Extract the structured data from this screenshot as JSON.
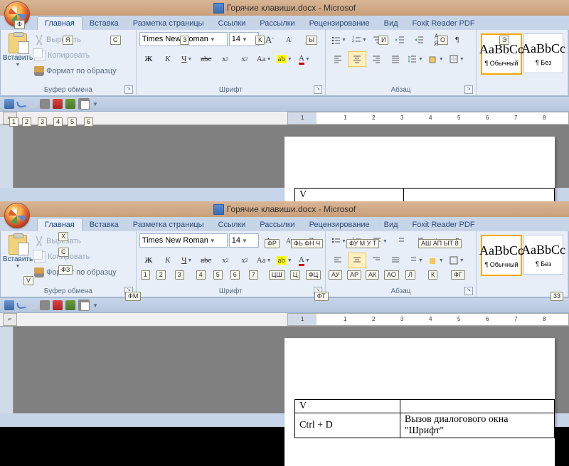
{
  "title": "Горячие клавиши.docx - Microsof",
  "office_keytip": "Ф",
  "tabs": [
    {
      "label": "Главная",
      "kt": "Я"
    },
    {
      "label": "Вставка",
      "kt": "С"
    },
    {
      "label": "Разметка страницы",
      "kt": "З"
    },
    {
      "label": "Ссылки",
      "kt": "К"
    },
    {
      "label": "Рассылки",
      "kt": "Ы"
    },
    {
      "label": "Рецензирование",
      "kt": "И"
    },
    {
      "label": "Вид",
      "kt": "О"
    },
    {
      "label": "Foxit Reader PDF",
      "kt": "Э"
    }
  ],
  "tabs2_kt": [
    "",
    "",
    "",
    "ФР",
    "ФЬ   ФН   Ч",
    "ФУ   М   У   Т",
    "АШ АП ЫТ   8",
    ""
  ],
  "clipboard": {
    "paste": "Вставить",
    "cut": "Вырезать",
    "copy": "Копировать",
    "format": "Формат по образцу",
    "label": "Буфер обмена",
    "kt_cut": "Х",
    "kt_copy": "С",
    "kt_format": "ФЗ",
    "kt_paste": "V",
    "kt_label": "ФМ"
  },
  "font": {
    "name": "Times New Roman",
    "size": "14",
    "label": "Шрифт",
    "kt_label": "ФТ",
    "row2_kt": [
      "1",
      "2",
      "3",
      "4",
      "5",
      "6",
      "7",
      "ЦШ",
      "Ц",
      "ФЦ"
    ]
  },
  "para": {
    "label": "Абзац",
    "kt_row": [
      "АУ",
      "АР",
      "АК",
      "АО",
      "Л",
      "К",
      "ФГ"
    ]
  },
  "styles": {
    "preview": "AaBbCc",
    "name1": "¶ Обычный",
    "name2": "¶ Без",
    "kt": "33"
  },
  "qat_numbers": [
    "1",
    "2",
    "3",
    "4",
    "5",
    "6"
  ],
  "ruler_numbers": [
    "1",
    "",
    "1",
    "2",
    "3",
    "4",
    "5",
    "6",
    "7",
    "8"
  ],
  "doc1_cell": "V",
  "doc2_cells": {
    "a": "V",
    "b": "Ctrl + D",
    "c": "Вызов диалогового окна \"Шрифт\""
  }
}
